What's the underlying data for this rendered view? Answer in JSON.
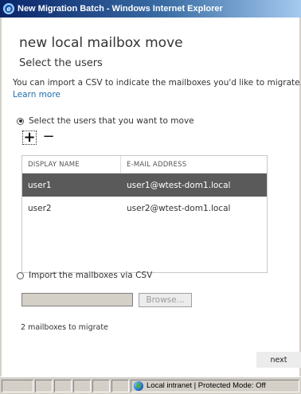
{
  "window": {
    "title": "New Migration Batch - Windows Internet Explorer"
  },
  "page": {
    "title": "new local mailbox move",
    "section_title": "Select the users",
    "intro": "You can import a CSV to indicate the mailboxes you'd like to migrate.",
    "learn_more": "Learn more"
  },
  "option_select": {
    "label": "Select the users that you want to move",
    "checked": true
  },
  "toolbar": {
    "add_symbol": "+",
    "remove_symbol": "−"
  },
  "grid": {
    "columns": [
      "DISPLAY NAME",
      "E-MAIL ADDRESS"
    ],
    "rows": [
      {
        "name": "user1",
        "email": "user1@wtest-dom1.local",
        "selected": true
      },
      {
        "name": "user2",
        "email": "user2@wtest-dom1.local",
        "selected": false
      }
    ]
  },
  "option_csv": {
    "label": "Import the mailboxes via CSV",
    "checked": false
  },
  "csv": {
    "file_value": "",
    "browse_label": "Browse..."
  },
  "summary": "2 mailboxes to migrate",
  "footer": {
    "next_label": "next"
  },
  "statusbar": {
    "zone": "Local intranet | Protected Mode: Off",
    "zone_icon": "globe-icon"
  }
}
